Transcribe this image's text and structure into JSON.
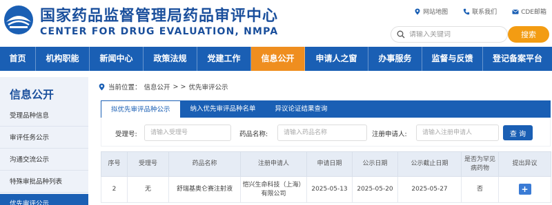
{
  "header": {
    "title_cn": "国家药品监督管理局药品审评中心",
    "title_en": "CENTER FOR DRUG EVALUATION, NMPA",
    "links": [
      {
        "label": "网站地图",
        "icon": "location-pin-icon"
      },
      {
        "label": "联系我们",
        "icon": "phone-icon"
      },
      {
        "label": "CDE邮箱",
        "icon": "mail-icon"
      }
    ],
    "search_placeholder": "请输入关键词",
    "search_button": "搜索"
  },
  "nav": {
    "items": [
      {
        "label": "首页"
      },
      {
        "label": "机构职能"
      },
      {
        "label": "新闻中心"
      },
      {
        "label": "政策法规"
      },
      {
        "label": "党建工作"
      },
      {
        "label": "信息公开"
      },
      {
        "label": "申请人之窗"
      },
      {
        "label": "办事服务"
      },
      {
        "label": "监督与反馈"
      },
      {
        "label": "登记备案平台"
      }
    ],
    "active_index": 5
  },
  "sidebar": {
    "title": "信息公开",
    "items": [
      {
        "label": "受理品种信息"
      },
      {
        "label": "审评任务公示"
      },
      {
        "label": "沟通交流公示"
      },
      {
        "label": "特殊审批品种列表"
      },
      {
        "label": "优先审评公示"
      }
    ]
  },
  "breadcrumb": {
    "prefix": "当前位置：",
    "home": "信息公开",
    "sep": "> >",
    "current": "优先审评公示"
  },
  "tabs": [
    {
      "label": "拟优先审评品种公示"
    },
    {
      "label": "纳入优先审评品种名单"
    },
    {
      "label": "异议论证结果查询"
    }
  ],
  "filters": {
    "accept_label": "受理号:",
    "accept_placeholder": "请输入受理号",
    "drug_label": "药品名称:",
    "drug_placeholder": "请输入药品名称",
    "applicant_label": "注册申请人:",
    "applicant_placeholder": "请输入注册申请人",
    "query_button": "查 询"
  },
  "table": {
    "headers": [
      "序号",
      "受理号",
      "药品名称",
      "注册申请人",
      "申请日期",
      "公示日期",
      "公示截止日期",
      "是否为罕见病药物",
      "提出异议"
    ],
    "rows": [
      {
        "no": "2",
        "accept_no": "无",
        "drug_name": "舒瑞基奥仑赛注射液",
        "applicant": "恺兴生命科技（上海）有限公司",
        "apply_date": "2025-05-13",
        "publish_date": "2025-05-20",
        "deadline": "2025-05-27",
        "rare_disease": "否",
        "objection": "+"
      }
    ]
  },
  "colors": {
    "primary": "#1a5fb4",
    "accent": "#ef8e1f",
    "brand_text": "#1a4f9c"
  }
}
